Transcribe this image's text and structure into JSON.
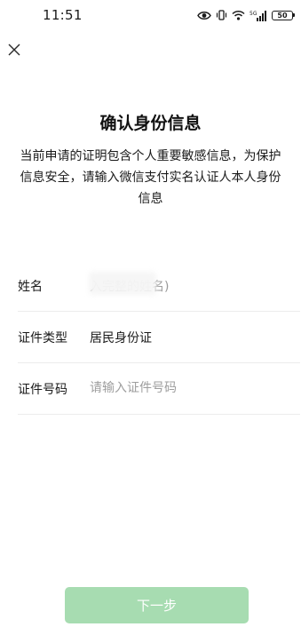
{
  "status_bar": {
    "time": "11:51",
    "network": "5G",
    "battery": "50",
    "icons": [
      "eye-icon",
      "vibrate-icon",
      "wifi-icon",
      "signal-icon",
      "battery-icon"
    ]
  },
  "nav": {
    "close_icon": "close-icon"
  },
  "header": {
    "title": "确认身份信息",
    "description": "当前申请的证明包含个人重要敏感信息，为保护信息安全，请输入微信支付实名认证人本人身份信息"
  },
  "form": {
    "name": {
      "label": "姓名",
      "value": "入完整的姓名)"
    },
    "id_type": {
      "label": "证件类型",
      "value": "居民身份证"
    },
    "id_number": {
      "label": "证件号码",
      "placeholder": "请输入证件号码"
    }
  },
  "footer": {
    "next_label": "下一步"
  },
  "colors": {
    "primary_disabled": "#a7dcb1",
    "text_primary": "#1a1a1a",
    "placeholder": "#9e9e9e",
    "divider": "#ececec"
  }
}
